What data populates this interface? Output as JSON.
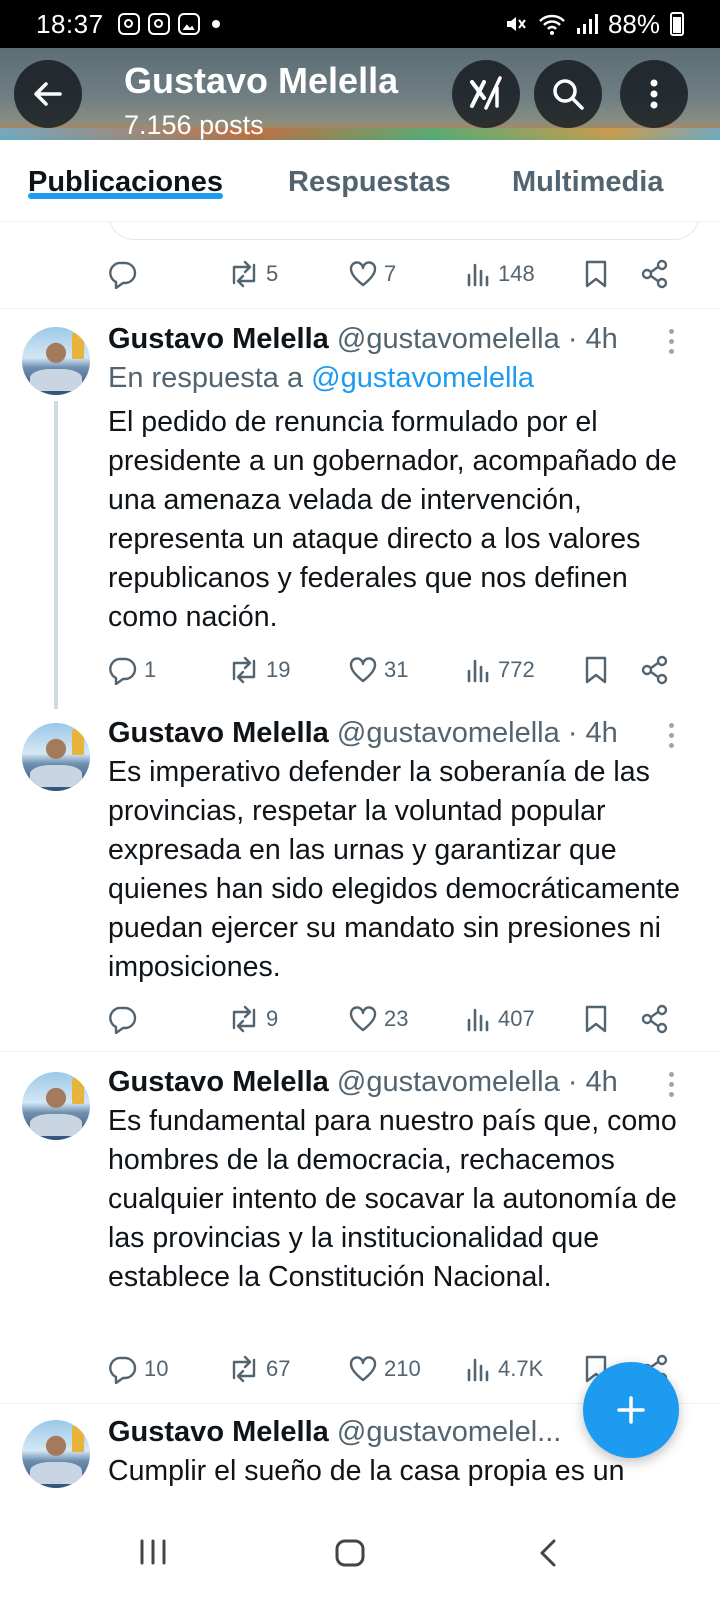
{
  "status_bar": {
    "time": "18:37",
    "battery": "88%"
  },
  "header": {
    "title": "Gustavo Melella",
    "posts": "7.156 posts"
  },
  "tabs": [
    {
      "label": "Publicaciones",
      "active": true
    },
    {
      "label": "Respuestas",
      "active": false
    },
    {
      "label": "Multimedia",
      "active": false
    }
  ],
  "previous_tweet_actions": {
    "replies": "",
    "reposts": "5",
    "likes": "7",
    "views": "148"
  },
  "tweets": [
    {
      "name": "Gustavo Melella",
      "meta": "@gustavomelella · 4h",
      "reply_prefix": "En respuesta a",
      "reply_handle": "@gustavomelella",
      "text": "El pedido de renuncia formulado por el presidente a un  gobernador, acompañado de una amenaza velada de intervención, representa un ataque directo a los valores republicanos y federales que nos definen como nación.",
      "replies": "1",
      "reposts": "19",
      "likes": "31",
      "views": "772"
    },
    {
      "name": "Gustavo Melella",
      "meta": "@gustavomelella · 4h",
      "text": "Es imperativo defender la soberanía de las provincias, respetar la voluntad popular expresada en las urnas y garantizar que quienes han sido elegidos democráticamente puedan ejercer su mandato sin presiones ni imposiciones.",
      "replies": "",
      "reposts": "9",
      "likes": "23",
      "views": "407"
    },
    {
      "name": "Gustavo Melella",
      "meta": "@gustavomelella · 4h",
      "text": "Es fundamental para nuestro país que, como hombres de la democracia, rechacemos cualquier  intento de socavar la autonomía de las provincias y la institucionalidad que establece la Constitución Nacional.",
      "replies": "10",
      "reposts": "67",
      "likes": "210",
      "views": "4.7K"
    },
    {
      "name": "Gustavo Melella",
      "meta": "@gustavomelel...",
      "text": "Cumplir el sueño de la casa propia es un"
    }
  ],
  "icons": {
    "back": "arrow-left-icon",
    "grok": "grok-icon",
    "search": "search-icon",
    "more": "more-vertical-icon",
    "reply": "reply-icon",
    "repost": "repost-icon",
    "like": "heart-icon",
    "views": "views-icon",
    "bookmark": "bookmark-icon",
    "share": "share-icon",
    "compose": "plus-icon"
  },
  "colors": {
    "accent": "#1d9bf0",
    "text": "#0f1419",
    "secondary": "#536471"
  }
}
